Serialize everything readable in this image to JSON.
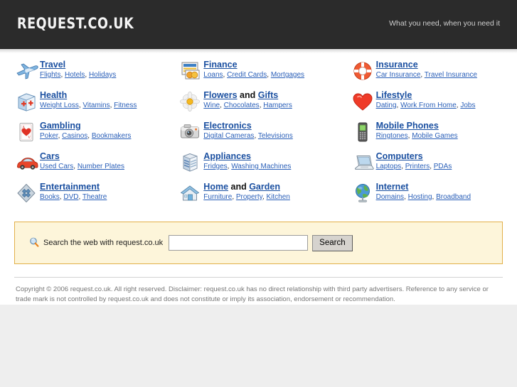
{
  "header": {
    "logo": "REQUEST.CO.UK",
    "tagline": "What you need, when you need it"
  },
  "categories": [
    {
      "title": "Travel",
      "icon": "airplane-icon",
      "subs": [
        "Flights",
        "Hotels",
        "Holidays"
      ]
    },
    {
      "title": "Finance",
      "icon": "credit-card-icon",
      "subs": [
        "Loans",
        "Credit Cards",
        "Mortgages"
      ]
    },
    {
      "title": "Insurance",
      "icon": "life-ring-icon",
      "subs": [
        "Car Insurance",
        "Travel Insurance"
      ]
    },
    {
      "title": "Health",
      "icon": "first-aid-kit-icon",
      "subs": [
        "Weight Loss",
        "Vitamins",
        "Fitness"
      ]
    },
    {
      "title": "Flowers and Gifts",
      "title_parts": [
        "Flowers",
        "and",
        "Gifts"
      ],
      "icon": "flower-icon",
      "subs": [
        "Wine",
        "Chocolates",
        "Hampers"
      ]
    },
    {
      "title": "Lifestyle",
      "icon": "heart-icon",
      "subs": [
        "Dating",
        "Work From Home",
        "Jobs"
      ]
    },
    {
      "title": "Gambling",
      "icon": "playing-card-icon",
      "subs": [
        "Poker",
        "Casinos",
        "Bookmakers"
      ]
    },
    {
      "title": "Electronics",
      "icon": "camera-icon",
      "subs": [
        "Digital Cameras",
        "Televisions"
      ]
    },
    {
      "title": "Mobile Phones",
      "icon": "mobile-phone-icon",
      "subs": [
        "Ringtones",
        "Mobile Games"
      ]
    },
    {
      "title": "Cars",
      "icon": "car-icon",
      "subs": [
        "Used Cars",
        "Number Plates"
      ]
    },
    {
      "title": "Appliances",
      "icon": "appliance-icon",
      "subs": [
        "Fridges",
        "Washing Machines"
      ]
    },
    {
      "title": "Computers",
      "icon": "laptop-icon",
      "subs": [
        "Laptops",
        "Printers",
        "PDAs"
      ]
    },
    {
      "title": "Entertainment",
      "icon": "film-reel-icon",
      "subs": [
        "Books",
        "DVD",
        "Theatre"
      ]
    },
    {
      "title": "Home and Garden",
      "title_parts": [
        "Home",
        "and",
        "Garden"
      ],
      "icon": "house-icon",
      "subs": [
        "Furniture",
        "Property",
        "Kitchen"
      ]
    },
    {
      "title": "Internet",
      "icon": "globe-icon",
      "subs": [
        "Domains",
        "Hosting",
        "Broadband"
      ]
    }
  ],
  "search": {
    "label": "Search the web with request.co.uk",
    "value": "",
    "placeholder": "",
    "button_label": "Search"
  },
  "footer": {
    "text": "Copyright © 2006 request.co.uk. All right reserved. Disclaimer: request.co.uk has no direct relationship with third party advertisers. Reference to any service or trade mark is not controlled by request.co.uk and does not constitute or imply its association, endorsement or recommendation."
  },
  "colors": {
    "header_bg": "#2b2b2b",
    "link": "#1a4fa0",
    "sublink": "#2a5fb8",
    "panel_bg": "#fdf5da",
    "panel_border": "#e2b04a",
    "page_bg": "#eeeeee"
  }
}
